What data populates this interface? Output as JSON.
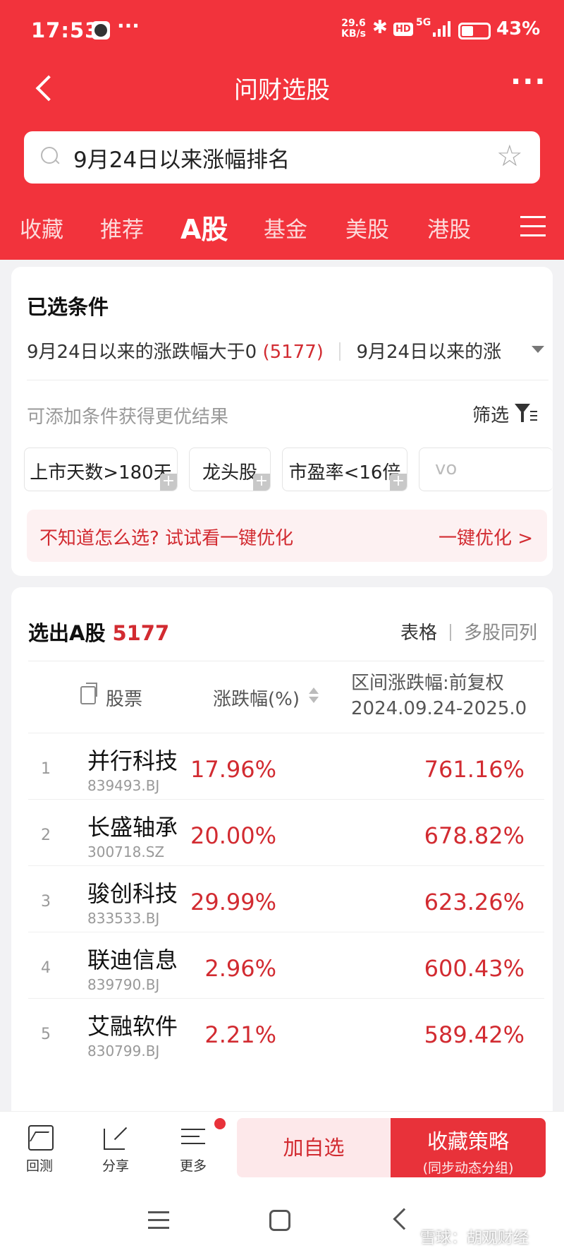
{
  "status": {
    "time": "17:53",
    "dots": "···",
    "speed_value": "29.6",
    "speed_unit": "KB/s",
    "hd": "HD",
    "signal": "5G",
    "battery": "43%",
    "battery_level": 0.43
  },
  "nav": {
    "title": "问财选股"
  },
  "search": {
    "value": "9月24日以来涨幅排名"
  },
  "tabs": [
    "收藏",
    "推荐",
    "A股",
    "基金",
    "美股",
    "港股"
  ],
  "conditions": {
    "title": "已选条件",
    "item1": "9月24日以来的涨跌幅大于0",
    "item1_count": "(5177)",
    "item2": "9月24日以来的涨",
    "hint": "可添加条件获得更优结果",
    "filter_label": "筛选",
    "chips": [
      "上市天数>180天",
      "龙头股",
      "市盈率<16倍",
      "vo"
    ],
    "optimize_hint": "不知道怎么选? 试试看一键优化",
    "optimize_link": "一键优化 >"
  },
  "results": {
    "title": "选出A股",
    "count": "5177",
    "view_table": "表格",
    "view_multi": "多股同列",
    "col_stock": "股票",
    "col_change": "涨跌幅(%)",
    "col_range_line1": "区间涨跌幅:前复权",
    "col_range_line2": "2024.09.24-2025.0",
    "rows": [
      {
        "idx": "1",
        "name": "并行科技",
        "code": "839493.BJ",
        "change": "17.96%",
        "range": "761.16%"
      },
      {
        "idx": "2",
        "name": "长盛轴承",
        "code": "300718.SZ",
        "change": "20.00%",
        "range": "678.82%"
      },
      {
        "idx": "3",
        "name": "骏创科技",
        "code": "833533.BJ",
        "change": "29.99%",
        "range": "623.26%"
      },
      {
        "idx": "4",
        "name": "联迪信息",
        "code": "839790.BJ",
        "change": "2.96%",
        "range": "600.43%"
      },
      {
        "idx": "5",
        "name": "艾融软件",
        "code": "830799.BJ",
        "change": "2.21%",
        "range": "589.42%"
      }
    ]
  },
  "actions": {
    "backtest": "回测",
    "share": "分享",
    "more": "更多",
    "add": "加自选",
    "fav": "收藏策略",
    "fav_sub": "(同步动态分组)"
  },
  "watermark": "雪球：胡观财经"
}
